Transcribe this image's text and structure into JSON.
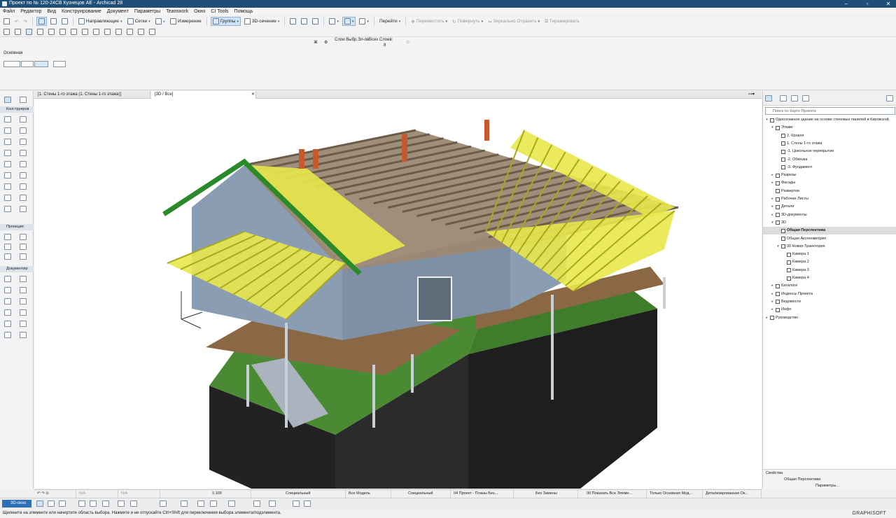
{
  "title": "Проект по № 120-24СВ Кузнецов АЕ - Archicad 28",
  "menu": [
    "Файл",
    "Редактор",
    "Вид",
    "Конструирование",
    "Документ",
    "Параметры",
    "Teamwork",
    "Окно",
    "CI Tools",
    "Помощь"
  ],
  "toolbar1": {
    "guides": "Направляющие",
    "grids": "Сетки",
    "measure": "Измерение",
    "groups": "Группы",
    "section3d": "3D-сечение",
    "goto": "Перейти",
    "move": "Переместить",
    "rotate": "Повернуть",
    "mirror": "Зеркально Отразить",
    "extrude": "Тиражировать"
  },
  "infobox": {
    "label": "Основная",
    "layers_label": "Слои Выбр.Эл-ов",
    "all_layers": "Всех Слоев:",
    "layers_count": "8"
  },
  "tabs": [
    "[1. Стены 1-го этажа (1. Стены 1-го этажа)]",
    "[3D / Все]"
  ],
  "toolbox": {
    "design": "Конструиров",
    "projection": "Проекция",
    "documenting": "Документир"
  },
  "navigator": {
    "search_placeholder": "Поиск по Карте Проекта",
    "items": [
      {
        "label": "Одноэтажное здание на основе стеновых панелей в Кировской",
        "level": 0,
        "arrow": "v"
      },
      {
        "label": "Этажи",
        "level": 1,
        "arrow": "v"
      },
      {
        "label": "2. Кровля",
        "level": 2,
        "arrow": ""
      },
      {
        "label": "1. Стены 1-го этажа",
        "level": 2,
        "arrow": ""
      },
      {
        "label": "-1. Цокольное перекрытие",
        "level": 2,
        "arrow": ""
      },
      {
        "label": "-2. Обвязка",
        "level": 2,
        "arrow": ""
      },
      {
        "label": "-3. Фундамент",
        "level": 2,
        "arrow": ""
      },
      {
        "label": "Разрезы",
        "level": 1,
        "arrow": ">"
      },
      {
        "label": "Фасады",
        "level": 1,
        "arrow": ">"
      },
      {
        "label": "Развертки",
        "level": 1,
        "arrow": ""
      },
      {
        "label": "Рабочие Листы",
        "level": 1,
        "arrow": ">"
      },
      {
        "label": "Детали",
        "level": 1,
        "arrow": ">"
      },
      {
        "label": "3D-документы",
        "level": 1,
        "arrow": ">"
      },
      {
        "label": "3D",
        "level": 1,
        "arrow": "v"
      },
      {
        "label": "Общая Перспектива",
        "level": 2,
        "arrow": "",
        "selected": true
      },
      {
        "label": "Общая Аксонометрия",
        "level": 2,
        "arrow": ""
      },
      {
        "label": "00 Новая Траектория",
        "level": 2,
        "arrow": "v"
      },
      {
        "label": "Камера 1",
        "level": 3,
        "arrow": ""
      },
      {
        "label": "Камера 2",
        "level": 3,
        "arrow": ""
      },
      {
        "label": "Камера 3",
        "level": 3,
        "arrow": ""
      },
      {
        "label": "Камера 4",
        "level": 3,
        "arrow": ""
      },
      {
        "label": "Каталоги",
        "level": 1,
        "arrow": ">"
      },
      {
        "label": "Индексы Проекта",
        "level": 1,
        "arrow": ">"
      },
      {
        "label": "Ведомости",
        "level": 1,
        "arrow": ">"
      },
      {
        "label": "Инфо",
        "level": 1,
        "arrow": ">"
      },
      {
        "label": "Руководство",
        "level": 0,
        "arrow": ">"
      }
    ],
    "props_title": "Свойства",
    "props_value": "Общая Перспектива",
    "params_button": "Параметры..."
  },
  "statusbar": {
    "zoom_a": "N/A",
    "zoom_b": "N/A",
    "scale": "1:100",
    "layers": "Специальный",
    "model": "Все Модель",
    "pen": "Специальный",
    "project": "04 Проект - Планы Без...",
    "override": "Без Замены",
    "renovation": "00 Показать Все Элеме...",
    "structure": "Только Основная Мод...",
    "detail": "Детализированная Ок..."
  },
  "viewbar": {
    "mode": "3D-окно"
  },
  "statusline": {
    "message": "Щелкните на элементе или начертите область выбора. Нажмите и не отпускайте Ctrl+Shift для переключения выбора элемента/подэлемента.",
    "brand": "GRAPHISOFT"
  },
  "colors": {
    "accent": "#2e6fb5",
    "titlebar": "#1f4e79",
    "roof_green": "#2a8a2a",
    "rafter_yellow": "#e8e84a"
  }
}
